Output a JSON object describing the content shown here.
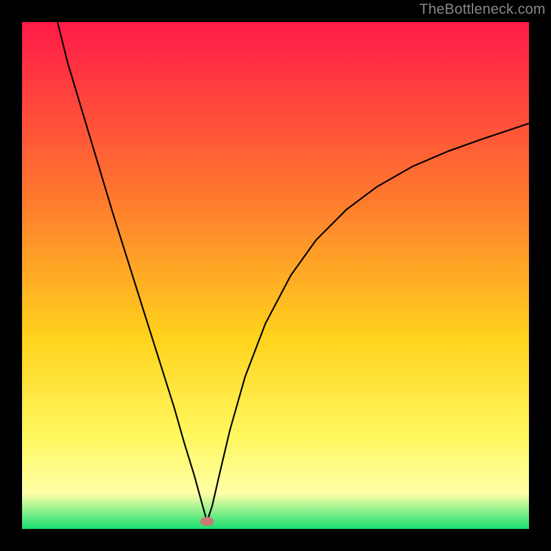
{
  "attribution": "TheBottleneck.com",
  "colors": {
    "bg_black": "#000000",
    "gradient_top": "#ff1a48",
    "gradient_mid1": "#ff7a2e",
    "gradient_mid2": "#ffd21c",
    "gradient_low1": "#fff860",
    "gradient_low2": "#ffffa8",
    "gradient_bottom": "#18e070",
    "curve": "#000000",
    "marker": "#c97a71",
    "attrib_text": "#888888"
  },
  "chart_data": {
    "type": "line",
    "title": "",
    "xlabel": "",
    "ylabel": "",
    "xlim": [
      0,
      100
    ],
    "ylim": [
      0,
      100
    ],
    "min_point": {
      "x": 36.5,
      "y": 1.5
    },
    "curve_points": [
      {
        "x": 7.0,
        "y": 100.0
      },
      {
        "x": 9.0,
        "y": 92.0
      },
      {
        "x": 12.0,
        "y": 82.0
      },
      {
        "x": 15.0,
        "y": 72.0
      },
      {
        "x": 18.0,
        "y": 62.0
      },
      {
        "x": 21.0,
        "y": 52.5
      },
      {
        "x": 24.0,
        "y": 43.0
      },
      {
        "x": 27.0,
        "y": 33.5
      },
      {
        "x": 30.0,
        "y": 24.0
      },
      {
        "x": 32.0,
        "y": 17.0
      },
      {
        "x": 34.0,
        "y": 10.5
      },
      {
        "x": 35.5,
        "y": 5.0
      },
      {
        "x": 36.5,
        "y": 1.5
      },
      {
        "x": 37.5,
        "y": 4.5
      },
      {
        "x": 39.0,
        "y": 11.0
      },
      {
        "x": 41.0,
        "y": 19.5
      },
      {
        "x": 44.0,
        "y": 30.0
      },
      {
        "x": 48.0,
        "y": 40.5
      },
      {
        "x": 53.0,
        "y": 50.0
      },
      {
        "x": 58.0,
        "y": 57.0
      },
      {
        "x": 64.0,
        "y": 63.0
      },
      {
        "x": 70.0,
        "y": 67.5
      },
      {
        "x": 77.0,
        "y": 71.5
      },
      {
        "x": 84.0,
        "y": 74.5
      },
      {
        "x": 91.0,
        "y": 77.0
      },
      {
        "x": 100.0,
        "y": 80.0
      }
    ]
  }
}
